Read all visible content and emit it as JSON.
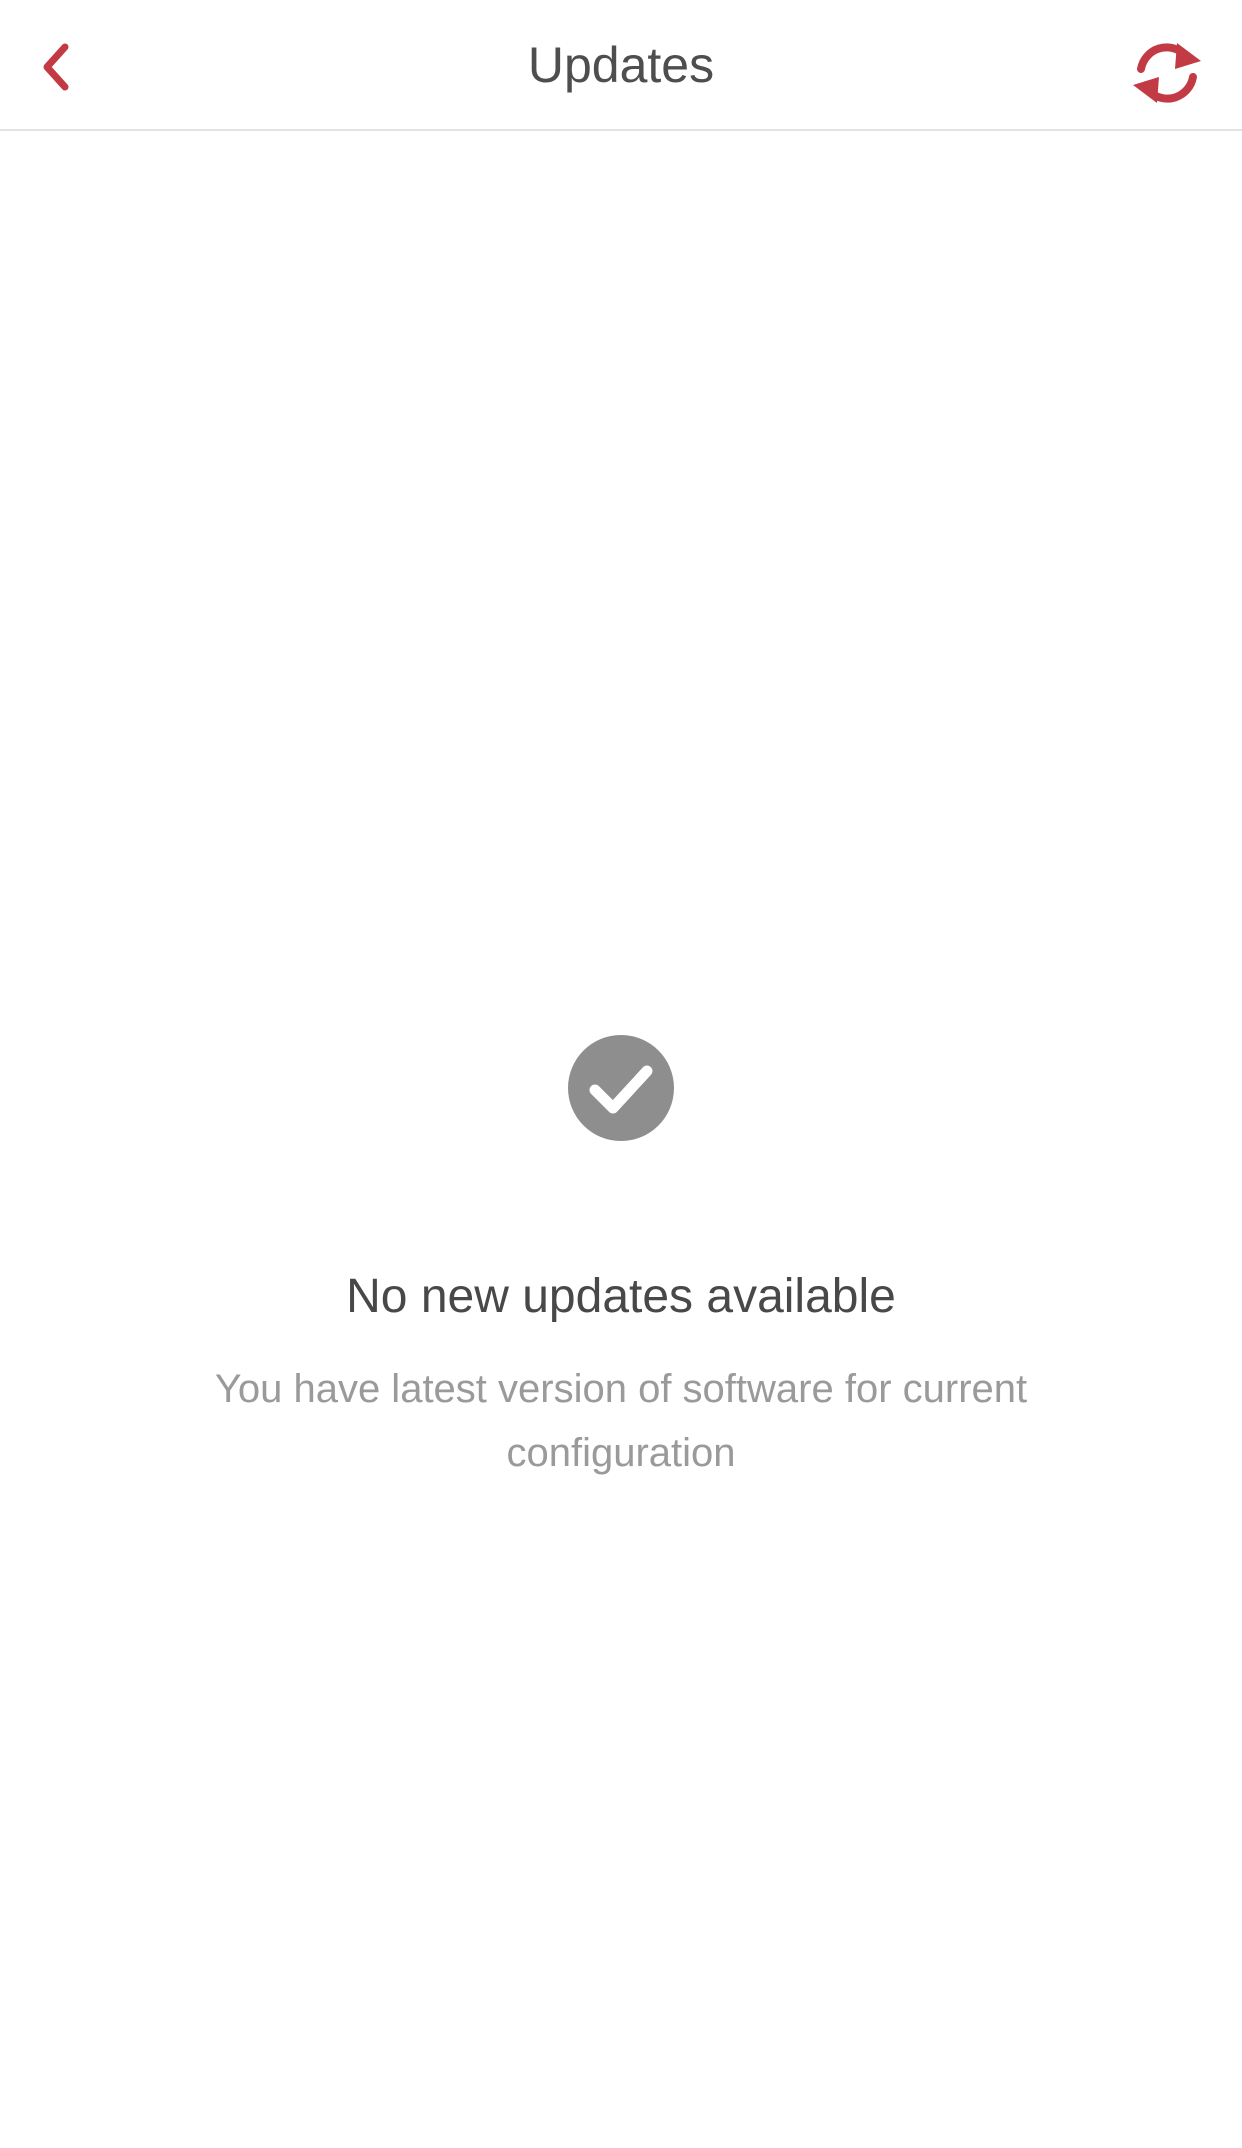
{
  "header": {
    "title": "Updates",
    "back_icon": "chevron-left-icon",
    "refresh_icon": "refresh-icon"
  },
  "status": {
    "icon": "check-circle-icon",
    "title": "No new updates available",
    "subtitle": "You have latest version of software for current configuration"
  },
  "colors": {
    "accent": "#c23a44",
    "icon_gray": "#8e8e8e",
    "title_text": "#4e4e4e",
    "subtitle_text": "#9a9a9a",
    "divider": "#e2e2e2"
  }
}
